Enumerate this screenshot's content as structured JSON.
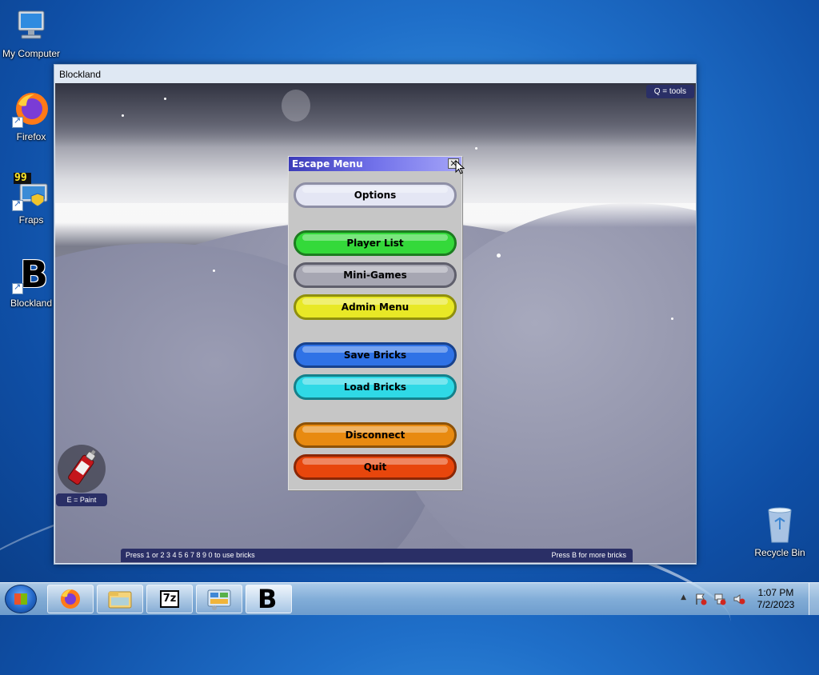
{
  "desktop": {
    "icons": [
      {
        "label": "My Computer"
      },
      {
        "label": "Firefox"
      },
      {
        "label": "Fraps"
      },
      {
        "label": "Blockland"
      },
      {
        "label": "Recycle Bin"
      }
    ],
    "fraps_counter": "99",
    "blockland_glyph": "B"
  },
  "window": {
    "title": "Blockland"
  },
  "game": {
    "tools_hint": "Q = tools",
    "paint_hint": "E = Paint",
    "bottom_left": "Press  1  or   2 3 4 5 6 7 8 9 0 to use bricks",
    "bottom_right": "Press  B  for more bricks"
  },
  "escape_menu": {
    "title": "Escape Menu",
    "close_glyph": "✕",
    "buttons": {
      "options": "Options",
      "player_list": "Player List",
      "mini_games": "Mini-Games",
      "admin_menu": "Admin Menu",
      "save_bricks": "Save Bricks",
      "load_bricks": "Load Bricks",
      "disconnect": "Disconnect",
      "quit": "Quit"
    }
  },
  "taskbar": {
    "seven_zip_label": "7z",
    "blockland_glyph": "B",
    "clock_time": "1:07 PM",
    "clock_date": "7/2/2023",
    "tray_up_glyph": "▲"
  },
  "colors": {
    "options": "#e4e6f4",
    "player_list": "#34d93a",
    "mini_games": "#a6a6b2",
    "admin_menu": "#e8e826",
    "save_bricks": "#2f72e6",
    "load_bricks": "#2fd9e6",
    "disconnect": "#e88a10",
    "quit": "#e8460c",
    "menu_title_start": "#3b3bb8",
    "hud_bar": "#2a2f66"
  }
}
